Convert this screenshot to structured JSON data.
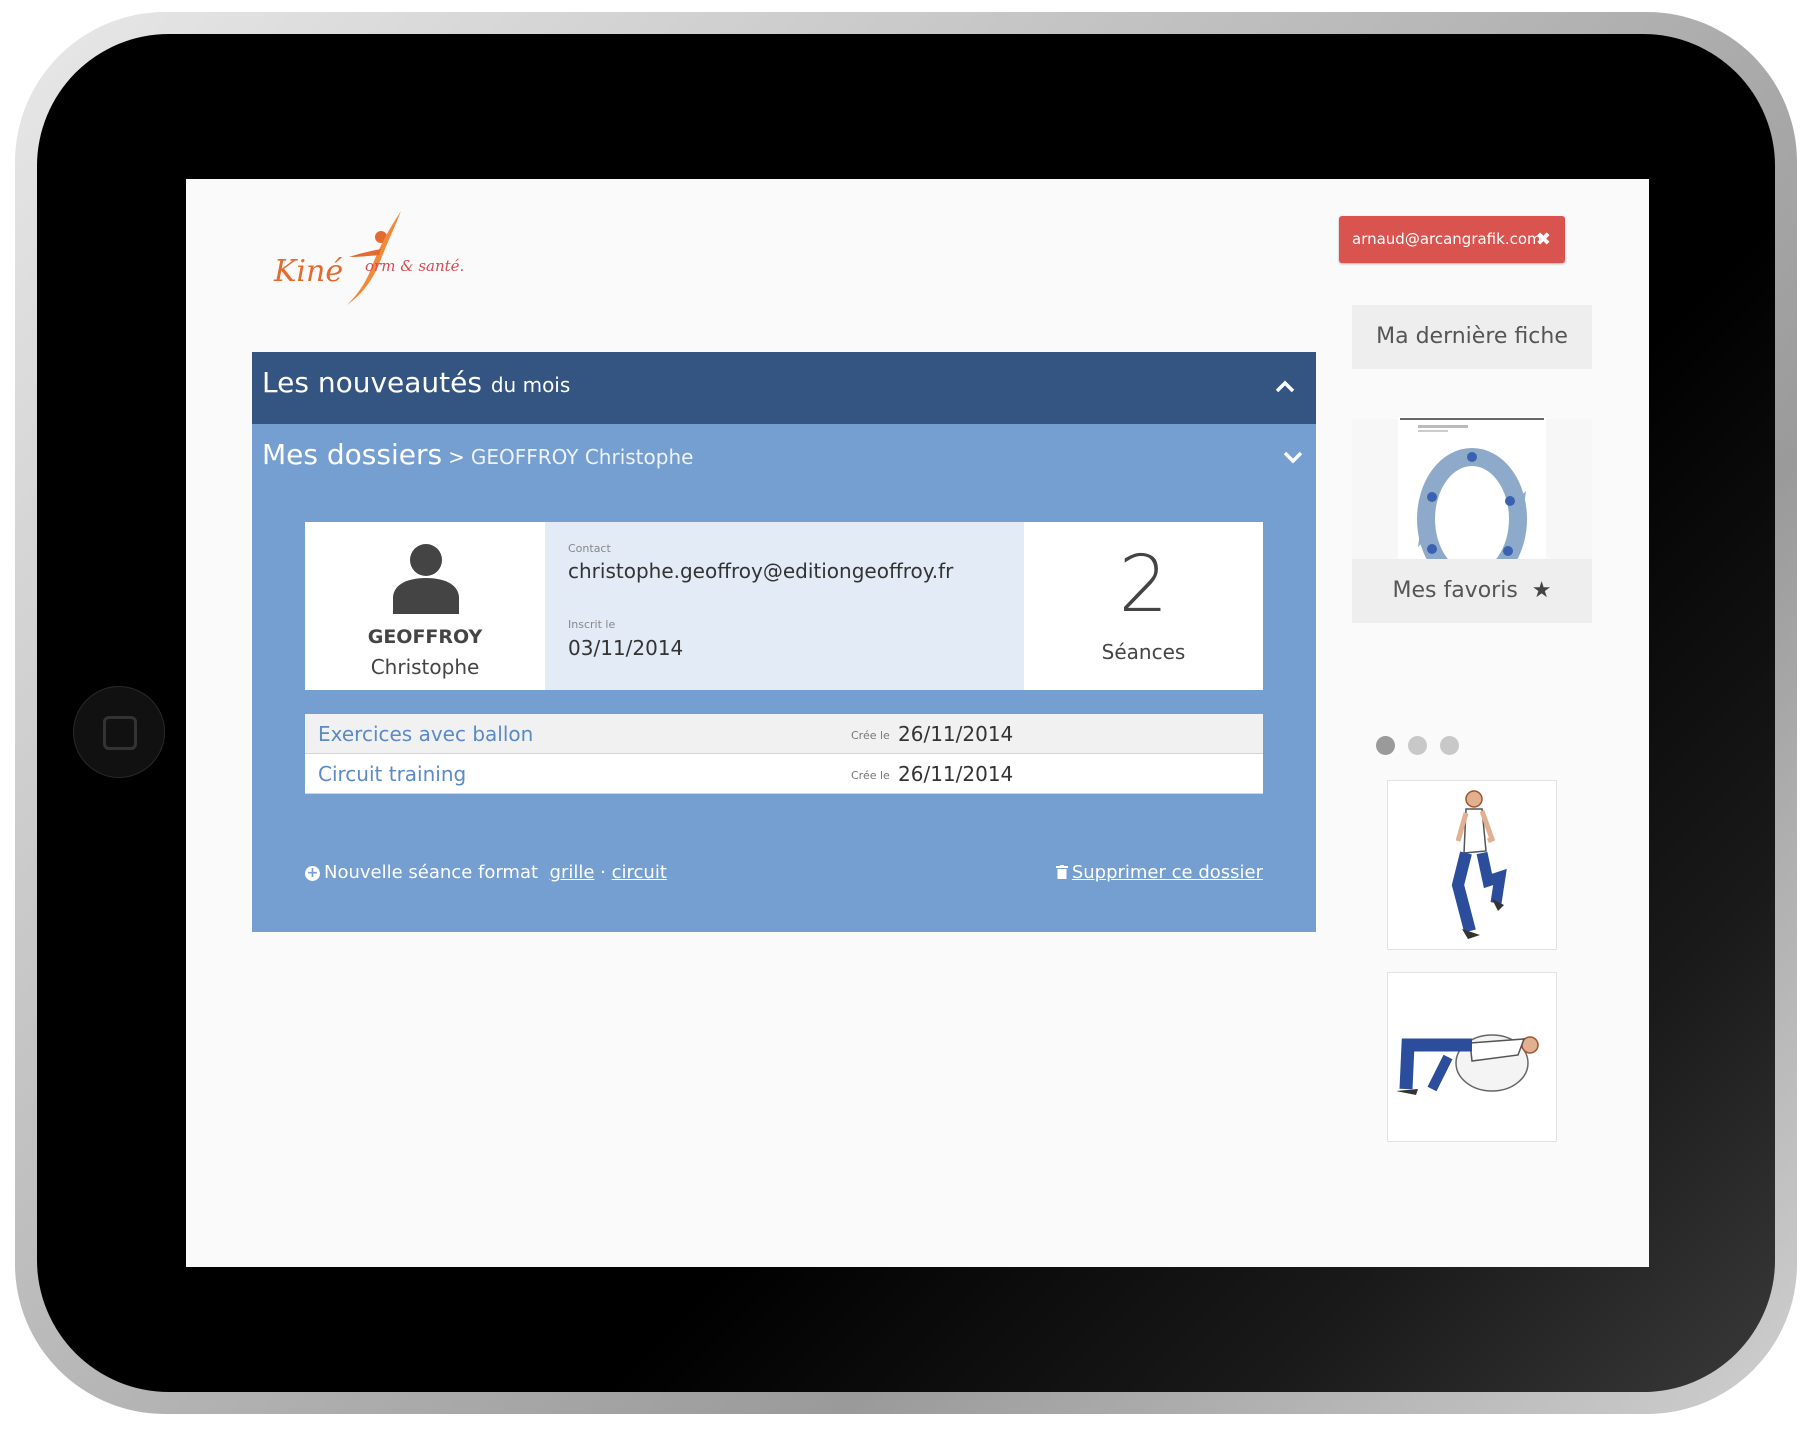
{
  "brand": {
    "logo_word": "Kiné",
    "logo_tagline": "orm & santé."
  },
  "header": {
    "user_email": "arnaud@arcangrafik.com",
    "logout_icon": "close-icon"
  },
  "panel_news": {
    "title": "Les nouveautés",
    "title_small": "du mois",
    "toggle_icon": "chevron-up-icon"
  },
  "panel_folders": {
    "title": "Mes dossiers",
    "separator": ">",
    "patient": "GEOFFROY Christophe",
    "toggle_icon": "chevron-down-icon",
    "card": {
      "last_name": "GEOFFROY",
      "first_name": "Christophe",
      "contact_label": "Contact",
      "contact_value": "christophe.geoffroy@editiongeoffroy.fr",
      "registered_label": "Inscrit le",
      "registered_value": "03/11/2014",
      "sessions_count": "2",
      "sessions_label": "Séances"
    },
    "sessions": [
      {
        "name": "Exercices avec ballon",
        "created_label": "Crée le",
        "date": "26/11/2014"
      },
      {
        "name": "Circuit training",
        "created_label": "Crée le",
        "date": "26/11/2014"
      }
    ],
    "actions": {
      "new_session": "Nouvelle séance format",
      "grid": "grille",
      "dot_sep": "·",
      "circuit": "circuit",
      "delete": "Supprimer ce dossier"
    }
  },
  "sidebar": {
    "last_sheet": "Ma dernière fiche",
    "favorites": "Mes favoris",
    "favorites_icon": "star-icon",
    "carousel_dots": 3,
    "carousel_active": 0
  },
  "colors": {
    "news_header": "#345582",
    "folders_body": "#759ed1",
    "logout": "#d9534f",
    "logo": "#e46a2e"
  }
}
